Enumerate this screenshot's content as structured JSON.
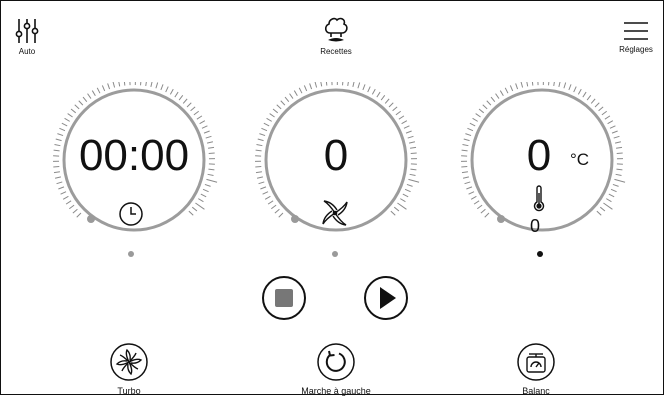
{
  "top_bar": {
    "mode_label": "Auto",
    "recipes_label": "Recettes",
    "settings_label": "Réglages"
  },
  "dials": {
    "time": {
      "value": "00:00",
      "icon": "clock-icon"
    },
    "speed": {
      "value": "0",
      "icon": "blade-icon"
    },
    "temperature": {
      "value": "0",
      "unit": "°C",
      "sub_value": "0",
      "icon": "thermometer-icon"
    }
  },
  "controls": {
    "stop": "stop-icon",
    "play": "play-icon"
  },
  "bottom_bar": {
    "turbo_label": "Turbo",
    "reverse_label": "Marche à gauche",
    "scale_label": "Balanc"
  },
  "colors": {
    "dial_ring": "#9c9c9c",
    "tick": "#8a8a8a",
    "dot_inactive": "#9a9a9a",
    "dot_active": "#111111"
  }
}
